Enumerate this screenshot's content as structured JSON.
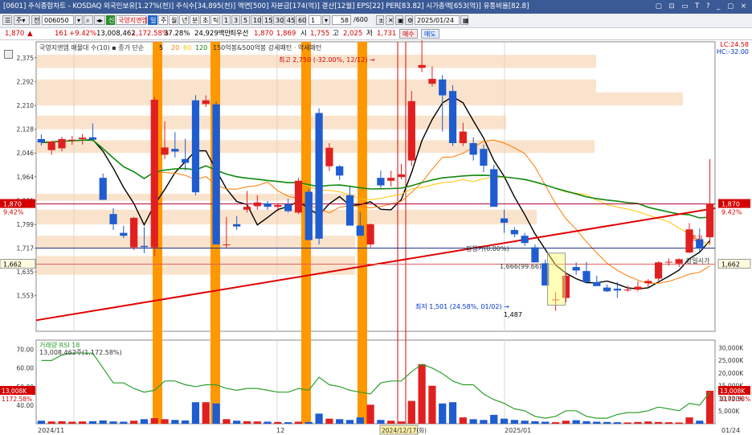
{
  "title_bar": {
    "text": "[0601] 주식종합차트 - KOSDAQ 외국인보유[1.27%(천)] 주식수[34,895(천)] 액면[500] 자본금[174(억)] 결산[12월] EPS[22] PER[83.82] 시가총액[653(억)] 유통비율[82.8]",
    "controls": "▢ ⊡ ▭ T ? _ ▢ ×"
  },
  "toolbar": {
    "stock_code": "006050",
    "credit_badge": "신",
    "stock_name": "국영지앤엠",
    "periods": [
      "일",
      "주",
      "월",
      "년",
      "분",
      "초",
      "틱"
    ],
    "minutes": [
      "1",
      "3",
      "5",
      "10",
      "15",
      "30",
      "45",
      "60"
    ],
    "count_value": "1",
    "display_count": "58",
    "total_count": "/600",
    "date": "2025/01/24"
  },
  "quote": {
    "price": "1,870",
    "arrow": "▲",
    "change": "161",
    "change_pct": "+9.42%",
    "volume": "13,008,462",
    "volume_ratio": "1,172.58%",
    "turnover": "37.28%",
    "amount": "24,929백만",
    "priority_label": "최우선",
    "ask": "1,870",
    "bid": "1,869",
    "open_label": "시",
    "open": "1,755",
    "high_label": "고",
    "high": "2,025",
    "low_label": "저",
    "low": "1,731",
    "buy_label": "매수",
    "sell_label": "매도"
  },
  "chart_data": {
    "type": "candlestick",
    "legend_text": "국영지앤엠 매물대 수(10)",
    "ma_legend_prefix": "종가 단순",
    "ma_periods": [
      "5",
      "20",
      "60",
      "120"
    ],
    "ma_colors": [
      "#000000",
      "#ff7a00",
      "#ffc400",
      "#118811",
      "#e00000"
    ],
    "pattern_text": "150억봉&500억봉 강세패턴 · 악세패턴",
    "lc_label": "LC:24.58",
    "hc_label": "HC:-32.00",
    "y_ticks": [
      2375,
      2292,
      2210,
      2128,
      2046,
      1964,
      1881,
      1799,
      1717,
      1635,
      1553
    ],
    "y_tick_labels": [
      "2,375",
      "2,292",
      "2,210",
      "2,128",
      "2,046",
      "1,964",
      "1,881",
      "1,799",
      "1,717",
      "1,635",
      "1,553"
    ],
    "price_labels": {
      "current": "1,870",
      "current_pct": "9.42%",
      "left_ref": "1,662",
      "right_ref": "1,662",
      "current_right": "1,870",
      "current_right_pct": "9.42%"
    },
    "annotations": {
      "high": "최고 2,750 (-32.00%, 12/12)",
      "low": "최저 1,501 (24.58%, 01/02)",
      "low_price": "1,487",
      "base1": "평행기(0.00%)",
      "base2": "1,666(99.66)",
      "right1": "종가",
      "right2": "당일시가"
    },
    "x_labels": [
      "2024/11",
      "12",
      "2024/12/17(화)",
      "2025/01",
      "01/24"
    ],
    "candles": [
      [
        2094,
        2110,
        2072,
        2082
      ],
      [
        2056,
        2087,
        2040,
        2085
      ],
      [
        2062,
        2102,
        2052,
        2094
      ],
      [
        2090,
        2105,
        2074,
        2092
      ],
      [
        2094,
        2112,
        2075,
        2099
      ],
      [
        2100,
        2148,
        2090,
        2092
      ],
      [
        1960,
        1975,
        1890,
        1884
      ],
      [
        1835,
        1855,
        1780,
        1800
      ],
      [
        1770,
        1795,
        1752,
        1760
      ],
      [
        1720,
        1825,
        1710,
        1822
      ],
      [
        1725,
        1790,
        1700,
        1721
      ],
      [
        1720,
        2240,
        1690,
        2230
      ],
      [
        2040,
        2155,
        2025,
        2065
      ],
      [
        2060,
        2118,
        2030,
        2051
      ],
      [
        2025,
        2095,
        1985,
        2012
      ],
      [
        2228,
        2246,
        1900,
        1910
      ],
      [
        2215,
        2245,
        2205,
        2228
      ],
      [
        2214,
        2224,
        1735,
        1730
      ],
      [
        1730,
        1825,
        1715,
        1730
      ],
      [
        1800,
        1828,
        1780,
        1792
      ],
      [
        1850,
        1915,
        1840,
        1860
      ],
      [
        1862,
        1900,
        1850,
        1875
      ],
      [
        1872,
        1880,
        1850,
        1860
      ],
      [
        1860,
        1872,
        1844,
        1866
      ],
      [
        1869,
        1888,
        1840,
        1845
      ],
      [
        1840,
        1960,
        1835,
        1950
      ],
      [
        1912,
        1922,
        1750,
        1745
      ],
      [
        2184,
        2200,
        1730,
        1750
      ],
      [
        2000,
        2080,
        1984,
        2064
      ],
      [
        2000,
        2004,
        1952,
        1968
      ],
      [
        1900,
        1930,
        1850,
        1795
      ],
      [
        1795,
        1842,
        1780,
        1760
      ],
      [
        1730,
        1802,
        1720,
        1800
      ],
      [
        1960,
        1985,
        1925,
        1934
      ],
      [
        1950,
        1985,
        1930,
        1960
      ],
      [
        1963,
        2008,
        1955,
        1972
      ],
      [
        2020,
        2260,
        2001,
        2225
      ],
      [
        2340,
        2750,
        2325,
        2350
      ],
      [
        2285,
        2345,
        2275,
        2302
      ],
      [
        2300,
        2315,
        2120,
        2245
      ],
      [
        2260,
        2280,
        2070,
        2080
      ],
      [
        2080,
        2150,
        2070,
        2120
      ],
      [
        2080,
        2100,
        2020,
        2040
      ],
      [
        2060,
        2075,
        1980,
        2002
      ],
      [
        1990,
        2005,
        1870,
        1860
      ],
      [
        1820,
        1850,
        1770,
        1805
      ],
      [
        1780,
        1790,
        1755,
        1765
      ],
      [
        1760,
        1770,
        1725,
        1735
      ],
      [
        1720,
        1730,
        1680,
        1668
      ],
      [
        1665,
        1678,
        1591,
        1588
      ],
      [
        1540,
        1565,
        1501,
        1540
      ],
      [
        1545,
        1635,
        1530,
        1622
      ],
      [
        1652,
        1668,
        1626,
        1640
      ],
      [
        1638,
        1670,
        1598,
        1600
      ],
      [
        1600,
        1622,
        1590,
        1586
      ],
      [
        1581,
        1592,
        1566,
        1568
      ],
      [
        1577,
        1600,
        1545,
        1571
      ],
      [
        1571,
        1588,
        1566,
        1574
      ],
      [
        1574,
        1602,
        1568,
        1584
      ],
      [
        1596,
        1610,
        1583,
        1604
      ],
      [
        1612,
        1672,
        1604,
        1668
      ],
      [
        1668,
        1682,
        1657,
        1670
      ],
      [
        1664,
        1682,
        1652,
        1679
      ],
      [
        1702,
        1804,
        1700,
        1782
      ],
      [
        1748,
        1785,
        1705,
        1716
      ],
      [
        1755,
        2025,
        1731,
        1870
      ]
    ],
    "sub_label": "거래량 RSI 18",
    "sub_volume_text": "13,008,462주(1,172.58%)",
    "sub_left_ticks": [
      "70.00",
      "60.00",
      "50.00",
      "40.00"
    ],
    "sub_left_values": [
      70,
      60,
      50,
      40
    ],
    "sub_right_ticks": [
      "30,000K",
      "25,000K",
      "20,000K",
      "15,000K",
      "10,000K",
      "5,000K"
    ],
    "sub_right_values": [
      30000,
      25000,
      20000,
      15000,
      10000,
      5000
    ],
    "sub_badge_left": "13,008K",
    "sub_badge_left_pct": "1172.58%",
    "sub_badge_right": "13,008K",
    "sub_badge_right_pct": "1172.58%",
    "volumes": [
      1200,
      900,
      1000,
      800,
      900,
      1000,
      1300,
      900,
      800,
      1200,
      1800,
      2200,
      1800,
      1500,
      1300,
      8500,
      8500,
      8000,
      1800,
      1200,
      1000,
      900,
      800,
      700,
      600,
      800,
      700,
      4000,
      2000,
      1800,
      1500,
      2500,
      7500,
      1500,
      1200,
      900,
      9000,
      23500,
      15000,
      8000,
      8500,
      2500,
      1800,
      1500,
      3500,
      2000,
      1500,
      1200,
      1000,
      800,
      600,
      1200,
      1400,
      1000,
      800,
      700,
      600,
      500,
      700,
      900,
      700,
      600,
      500,
      2500,
      1200,
      13008
    ],
    "rsi": [
      64,
      64,
      67,
      68,
      68,
      68,
      60,
      52,
      52,
      49,
      47,
      48,
      53,
      53,
      51,
      50,
      51,
      51,
      49,
      48,
      49,
      49,
      48,
      47,
      47,
      49,
      48,
      55,
      51,
      50,
      48,
      47,
      46,
      52,
      53,
      53,
      58,
      62,
      60,
      57,
      53,
      51,
      51,
      46,
      43,
      41,
      38,
      37,
      34,
      33,
      34,
      37,
      37,
      34,
      33,
      33,
      35,
      36,
      36,
      37,
      39,
      38,
      37,
      41,
      40,
      47
    ]
  }
}
